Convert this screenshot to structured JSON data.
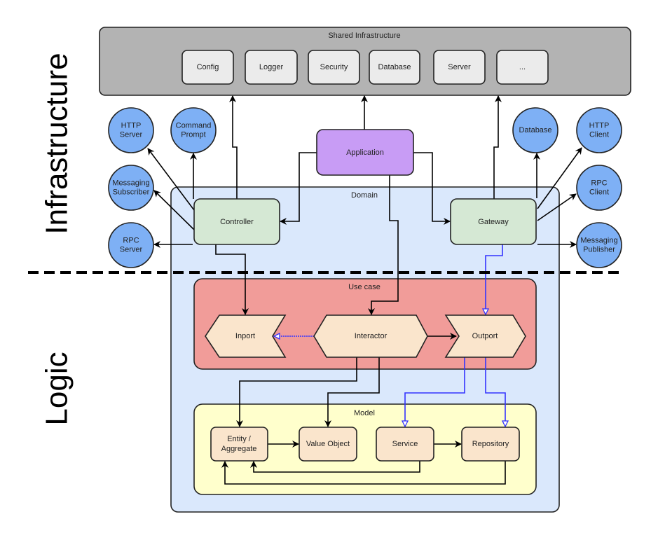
{
  "layers": {
    "infrastructure": "Infrastructure",
    "logic": "Logic"
  },
  "shared": {
    "title": "Shared Infrastructure",
    "items": [
      "Config",
      "Logger",
      "Security",
      "Database",
      "Server",
      "..."
    ]
  },
  "application": "Application",
  "domain": {
    "title": "Domain",
    "controller": "Controller",
    "gateway": "Gateway"
  },
  "left_circles": [
    [
      "HTTP",
      "Server"
    ],
    [
      "Command",
      "Prompt"
    ],
    [
      "Messaging",
      "Subscriber"
    ],
    [
      "RPC",
      "Server"
    ]
  ],
  "right_circles": [
    [
      "Database"
    ],
    [
      "HTTP",
      "Client"
    ],
    [
      "RPC",
      "Client"
    ],
    [
      "Messaging",
      "Publisher"
    ]
  ],
  "usecase": {
    "title": "Use case",
    "inport": "Inport",
    "interactor": "Interactor",
    "outport": "Outport"
  },
  "model": {
    "title": "Model",
    "entity": [
      "Entity /",
      "Aggregate"
    ],
    "value_object": "Value Object",
    "service": "Service",
    "repository": "Repository"
  },
  "colors": {
    "shared": "#b3b3b3",
    "shared_item": "#ebebeb",
    "application": "#c89cf5",
    "domain": "#dae8fc",
    "adapter": "#d5e8d4",
    "circle": "#7eb0f5",
    "usecase": "#f19c99",
    "model": "#ffffcc",
    "node": "#fae5cc",
    "blue_edge": "#3333ff"
  }
}
